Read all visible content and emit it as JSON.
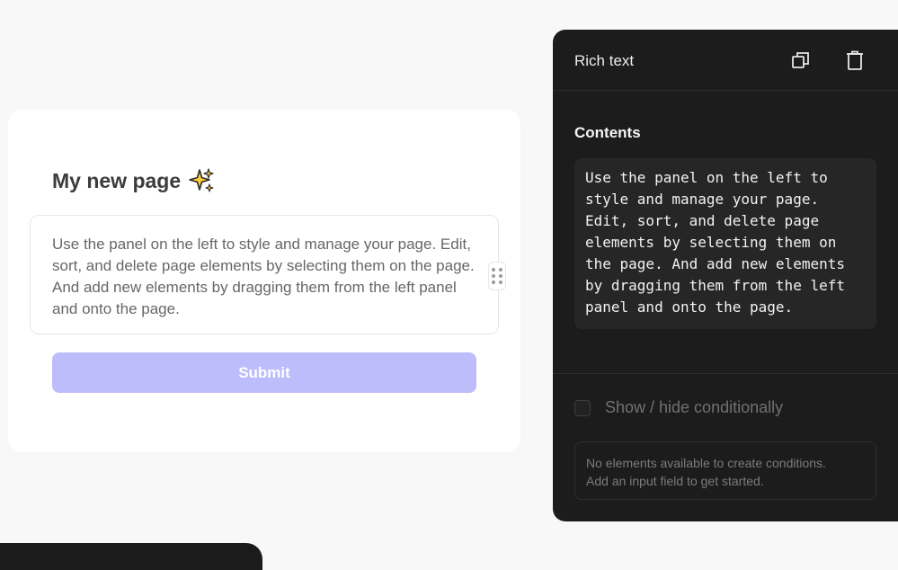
{
  "page": {
    "title": "My new page",
    "title_icon": "sparkles-icon",
    "rich_text": "Use the panel on the left to style and manage your page. Edit, sort, and delete page elements by selecting them on the page. And add new elements by dragging them from the left panel and onto the page.",
    "submit_label": "Submit"
  },
  "panel": {
    "title": "Rich text",
    "header_icons": [
      "duplicate-icon",
      "trash-icon"
    ],
    "contents_label": "Contents",
    "contents_value": "Use the panel on the left to style and manage your page. Edit, sort, and delete page elements by selecting them on the page. And add new elements by dragging them from the left panel and onto the page.",
    "conditional_label": "Show / hide conditionally",
    "conditional_checked": false,
    "conditions_notice_line1": "No elements available to create conditions.",
    "conditions_notice_line2": "Add an input field to get started."
  },
  "colors": {
    "submit_button": "#bdbdfc",
    "panel_background": "#1c1c1c",
    "canvas_background": "#f8f8f8"
  }
}
